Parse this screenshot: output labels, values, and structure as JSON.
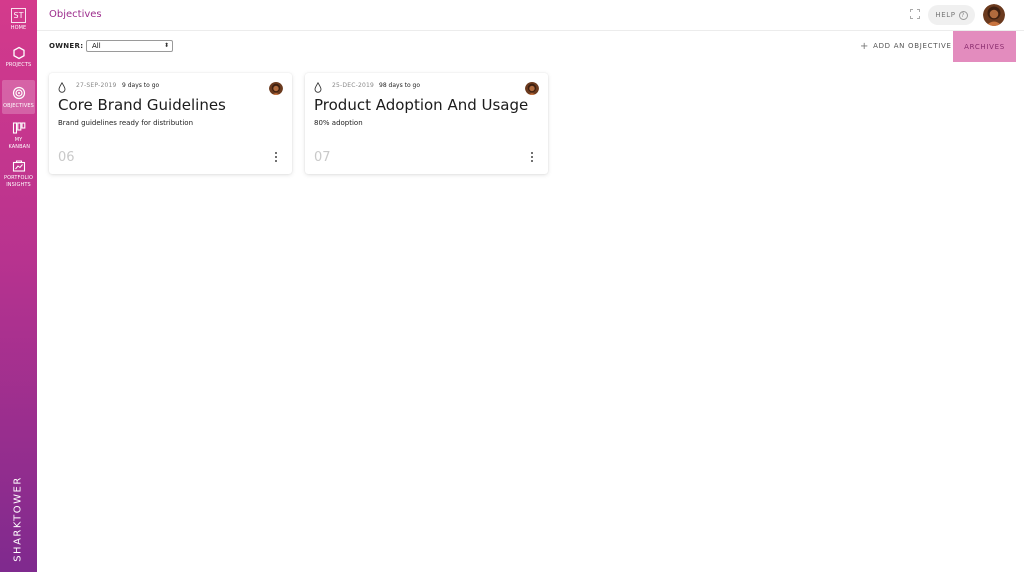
{
  "sidebar": {
    "home": {
      "badge": "ST",
      "label": "HOME"
    },
    "items": [
      {
        "id": "projects",
        "label": "PROJECTS",
        "icon": "hexagon-icon"
      },
      {
        "id": "objectives",
        "label": "OBJECTIVES",
        "icon": "target-icon",
        "active": true
      },
      {
        "id": "my-kanban",
        "label": "MY KANBAN",
        "icon": "kanban-icon"
      },
      {
        "id": "portfolio-insights",
        "label": "PORTFOLIO INSIGHTS",
        "icon": "portfolio-icon"
      }
    ],
    "brand": "SHARKTOWER"
  },
  "header": {
    "title": "Objectives",
    "help_label": "HELP",
    "help_icon": "?"
  },
  "toolbar": {
    "owner_label": "OWNER:",
    "owner_value": "All",
    "add_objective_label": "ADD AN OBJECTIVE",
    "archives_label": "ARCHIVES"
  },
  "colors": {
    "accent": "#9c2b8c",
    "archives_bg": "#e38cbe",
    "sidebar_top": "#d43a8c",
    "sidebar_bottom": "#7f2a8e"
  },
  "objectives": [
    {
      "date": "27-SEP-2019",
      "due": "9 days to go",
      "title": "Core Brand Guidelines",
      "description": "Brand guidelines ready for distribution",
      "number": "06"
    },
    {
      "date": "25-DEC-2019",
      "due": "98 days to go",
      "title": "Product Adoption And Usage",
      "description": "80% adoption",
      "number": "07"
    }
  ]
}
